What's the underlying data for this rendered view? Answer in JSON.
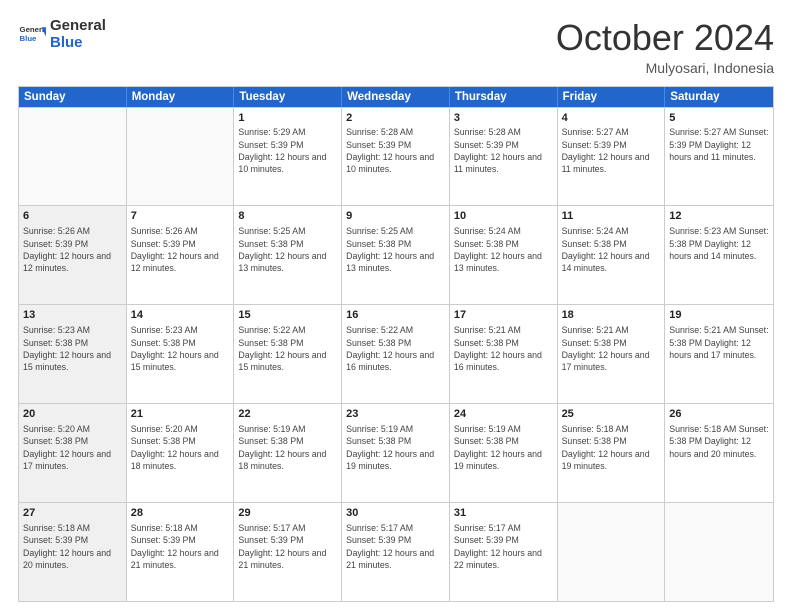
{
  "logo": {
    "general": "General",
    "blue": "Blue"
  },
  "header": {
    "month": "October 2024",
    "location": "Mulyosari, Indonesia"
  },
  "weekdays": [
    "Sunday",
    "Monday",
    "Tuesday",
    "Wednesday",
    "Thursday",
    "Friday",
    "Saturday"
  ],
  "weeks": [
    [
      {
        "day": "",
        "info": "",
        "empty": true
      },
      {
        "day": "",
        "info": "",
        "empty": true
      },
      {
        "day": "1",
        "info": "Sunrise: 5:29 AM\nSunset: 5:39 PM\nDaylight: 12 hours and 10 minutes."
      },
      {
        "day": "2",
        "info": "Sunrise: 5:28 AM\nSunset: 5:39 PM\nDaylight: 12 hours and 10 minutes."
      },
      {
        "day": "3",
        "info": "Sunrise: 5:28 AM\nSunset: 5:39 PM\nDaylight: 12 hours and 11 minutes."
      },
      {
        "day": "4",
        "info": "Sunrise: 5:27 AM\nSunset: 5:39 PM\nDaylight: 12 hours and 11 minutes."
      },
      {
        "day": "5",
        "info": "Sunrise: 5:27 AM\nSunset: 5:39 PM\nDaylight: 12 hours and 11 minutes."
      }
    ],
    [
      {
        "day": "6",
        "info": "Sunrise: 5:26 AM\nSunset: 5:39 PM\nDaylight: 12 hours and 12 minutes.",
        "shaded": true
      },
      {
        "day": "7",
        "info": "Sunrise: 5:26 AM\nSunset: 5:39 PM\nDaylight: 12 hours and 12 minutes."
      },
      {
        "day": "8",
        "info": "Sunrise: 5:25 AM\nSunset: 5:38 PM\nDaylight: 12 hours and 13 minutes."
      },
      {
        "day": "9",
        "info": "Sunrise: 5:25 AM\nSunset: 5:38 PM\nDaylight: 12 hours and 13 minutes."
      },
      {
        "day": "10",
        "info": "Sunrise: 5:24 AM\nSunset: 5:38 PM\nDaylight: 12 hours and 13 minutes."
      },
      {
        "day": "11",
        "info": "Sunrise: 5:24 AM\nSunset: 5:38 PM\nDaylight: 12 hours and 14 minutes."
      },
      {
        "day": "12",
        "info": "Sunrise: 5:23 AM\nSunset: 5:38 PM\nDaylight: 12 hours and 14 minutes."
      }
    ],
    [
      {
        "day": "13",
        "info": "Sunrise: 5:23 AM\nSunset: 5:38 PM\nDaylight: 12 hours and 15 minutes.",
        "shaded": true
      },
      {
        "day": "14",
        "info": "Sunrise: 5:23 AM\nSunset: 5:38 PM\nDaylight: 12 hours and 15 minutes."
      },
      {
        "day": "15",
        "info": "Sunrise: 5:22 AM\nSunset: 5:38 PM\nDaylight: 12 hours and 15 minutes."
      },
      {
        "day": "16",
        "info": "Sunrise: 5:22 AM\nSunset: 5:38 PM\nDaylight: 12 hours and 16 minutes."
      },
      {
        "day": "17",
        "info": "Sunrise: 5:21 AM\nSunset: 5:38 PM\nDaylight: 12 hours and 16 minutes."
      },
      {
        "day": "18",
        "info": "Sunrise: 5:21 AM\nSunset: 5:38 PM\nDaylight: 12 hours and 17 minutes."
      },
      {
        "day": "19",
        "info": "Sunrise: 5:21 AM\nSunset: 5:38 PM\nDaylight: 12 hours and 17 minutes."
      }
    ],
    [
      {
        "day": "20",
        "info": "Sunrise: 5:20 AM\nSunset: 5:38 PM\nDaylight: 12 hours and 17 minutes.",
        "shaded": true
      },
      {
        "day": "21",
        "info": "Sunrise: 5:20 AM\nSunset: 5:38 PM\nDaylight: 12 hours and 18 minutes."
      },
      {
        "day": "22",
        "info": "Sunrise: 5:19 AM\nSunset: 5:38 PM\nDaylight: 12 hours and 18 minutes."
      },
      {
        "day": "23",
        "info": "Sunrise: 5:19 AM\nSunset: 5:38 PM\nDaylight: 12 hours and 19 minutes."
      },
      {
        "day": "24",
        "info": "Sunrise: 5:19 AM\nSunset: 5:38 PM\nDaylight: 12 hours and 19 minutes."
      },
      {
        "day": "25",
        "info": "Sunrise: 5:18 AM\nSunset: 5:38 PM\nDaylight: 12 hours and 19 minutes."
      },
      {
        "day": "26",
        "info": "Sunrise: 5:18 AM\nSunset: 5:38 PM\nDaylight: 12 hours and 20 minutes."
      }
    ],
    [
      {
        "day": "27",
        "info": "Sunrise: 5:18 AM\nSunset: 5:39 PM\nDaylight: 12 hours and 20 minutes.",
        "shaded": true
      },
      {
        "day": "28",
        "info": "Sunrise: 5:18 AM\nSunset: 5:39 PM\nDaylight: 12 hours and 21 minutes."
      },
      {
        "day": "29",
        "info": "Sunrise: 5:17 AM\nSunset: 5:39 PM\nDaylight: 12 hours and 21 minutes."
      },
      {
        "day": "30",
        "info": "Sunrise: 5:17 AM\nSunset: 5:39 PM\nDaylight: 12 hours and 21 minutes."
      },
      {
        "day": "31",
        "info": "Sunrise: 5:17 AM\nSunset: 5:39 PM\nDaylight: 12 hours and 22 minutes."
      },
      {
        "day": "",
        "info": "",
        "empty": true
      },
      {
        "day": "",
        "info": "",
        "empty": true
      }
    ]
  ]
}
